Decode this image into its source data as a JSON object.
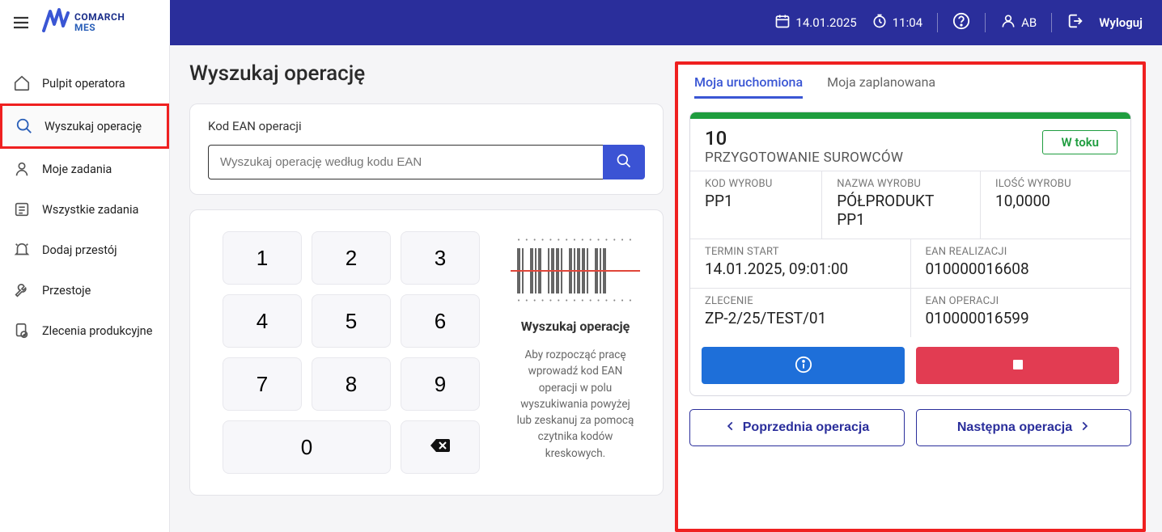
{
  "brand": {
    "line1": "COMARCH",
    "line2": "MES"
  },
  "header": {
    "date": "14.01.2025",
    "time": "11:04",
    "user": "AB",
    "logout": "Wyloguj"
  },
  "sidebar": {
    "items": [
      {
        "label": "Pulpit operatora"
      },
      {
        "label": "Wyszukaj operację"
      },
      {
        "label": "Moje zadania"
      },
      {
        "label": "Wszystkie zadania"
      },
      {
        "label": "Dodaj przestój"
      },
      {
        "label": "Przestoje"
      },
      {
        "label": "Zlecenia produkcyjne"
      }
    ]
  },
  "page": {
    "title": "Wyszukaj operację",
    "searchLabel": "Kod EAN operacji",
    "searchPlaceholder": "Wyszukaj operację według kodu EAN",
    "keypad": [
      "1",
      "2",
      "3",
      "4",
      "5",
      "6",
      "7",
      "8",
      "9",
      "0"
    ],
    "keypadTitle": "Wyszukaj operację",
    "keypadHelp": "Aby rozpocząć pracę wprowadź kod EAN operacji w polu wyszukiwania powyżej lub zeskanuj za pomocą czytnika kodów kreskowych."
  },
  "right": {
    "tabs": [
      "Moja uruchomiona",
      "Moja zaplanowana"
    ],
    "op": {
      "num": "10",
      "title": "PRZYGOTOWANIE SUROWCÓW",
      "status": "W toku",
      "fields": {
        "kodWyrobuLabel": "KOD WYROBU",
        "kodWyrobu": "PP1",
        "nazwaWyrobuLabel": "NAZWA WYROBU",
        "nazwaWyrobu": "PÓŁPRODUKT PP1",
        "iloscWyrobuLabel": "ILOŚĆ WYROBU",
        "iloscWyrobu": "10,0000",
        "terminStartLabel": "TERMIN START",
        "terminStart": "14.01.2025, 09:01:00",
        "eanRealizacjiLabel": "EAN REALIZACJI",
        "eanRealizacji": "010000016608",
        "zlecenieLabel": "ZLECENIE",
        "zlecenie": "ZP-2/25/TEST/01",
        "eanOperacjiLabel": "EAN OPERACJI",
        "eanOperacji": "010000016599"
      }
    },
    "prev": "Poprzednia operacja",
    "next": "Następna operacja"
  }
}
